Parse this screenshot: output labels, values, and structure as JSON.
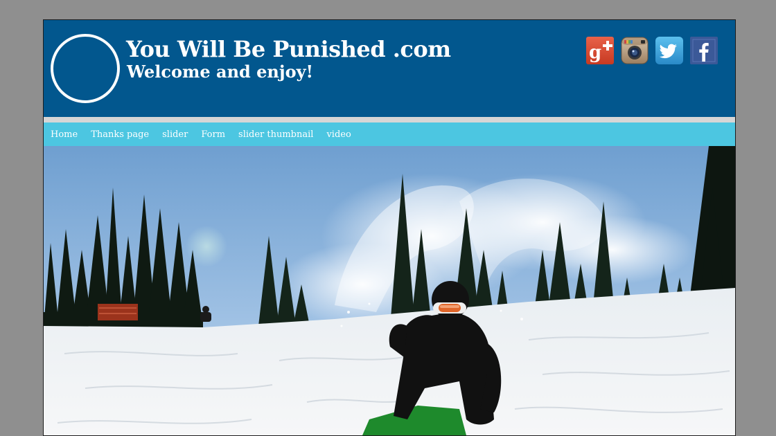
{
  "header": {
    "title": "You Will Be Punished .com",
    "tagline": "Welcome and enjoy!",
    "social": [
      {
        "name": "google-plus",
        "icon": "google-plus-icon",
        "color": "#d6452f"
      },
      {
        "name": "instagram",
        "icon": "instagram-icon",
        "color": "#a38a6e"
      },
      {
        "name": "twitter",
        "icon": "twitter-icon",
        "color": "#3aa2d8"
      },
      {
        "name": "facebook",
        "icon": "facebook-icon",
        "color": "#3b5998"
      }
    ]
  },
  "nav": {
    "items": [
      "Home",
      "Thanks page",
      "slider",
      "Form",
      "slider thumbnail",
      "video"
    ]
  },
  "hero": {
    "image": "snowboarder-photo"
  },
  "colors": {
    "header_bg": "#02578e",
    "nav_bg": "#4cc6e1",
    "separator": "#d6d6d6",
    "page_bg": "#8f8f8f"
  }
}
